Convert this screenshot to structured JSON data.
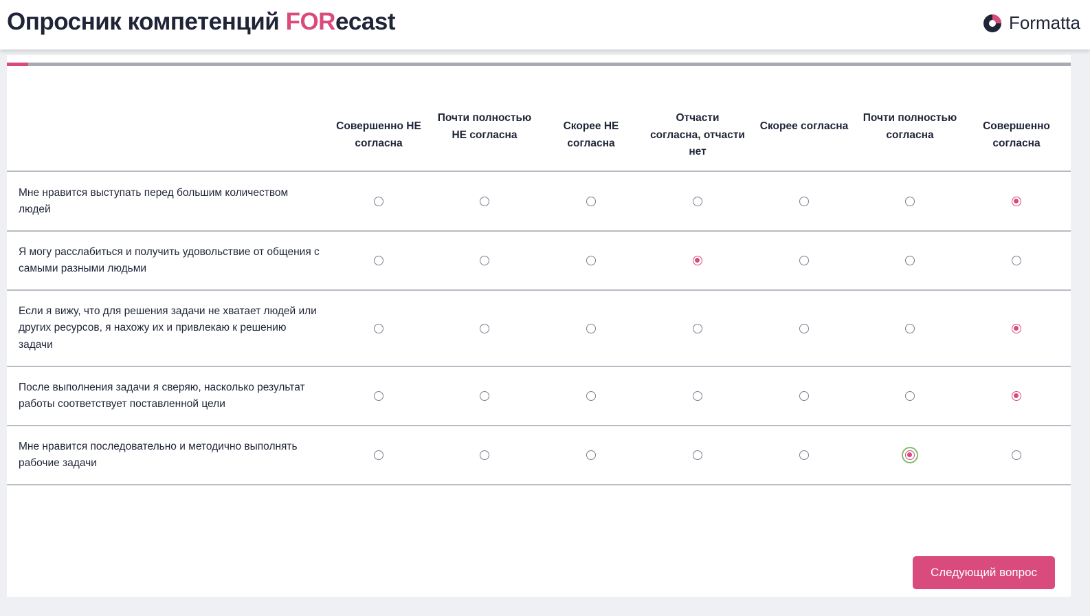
{
  "header": {
    "title_main": "Опросник компетенций ",
    "title_accent": "FOR",
    "title_rest": "ecast",
    "logo_text": "Formatta",
    "logo_icon": "formatta-logo-icon"
  },
  "colors": {
    "accent": "#d94a7d",
    "text": "#1f2537",
    "divider": "#b9bcc4",
    "focus": "#7dbf6a"
  },
  "progress": {
    "value_percent": 2
  },
  "scale": {
    "columns": [
      "Совершенно НЕ согласна",
      "Почти полностью НЕ согласна",
      "Скорее НЕ согласна",
      "Отчасти согласна, отчасти нет",
      "Скорее согласна",
      "Почти полностью согласна",
      "Совершенно согласна"
    ]
  },
  "questions": [
    {
      "text": "Мне нравится выступать перед большим количеством людей",
      "selected_index": 6
    },
    {
      "text": "Я могу расслабиться и получить удовольствие от общения с самыми разными людьми",
      "selected_index": 3
    },
    {
      "text": "Если я вижу, что для решения задачи не хватает людей или других ресурсов, я нахожу их и привлекаю к решению задачи",
      "selected_index": 6
    },
    {
      "text": "После выполнения задачи я сверяю, насколько результат работы соответствует поставленной цели",
      "selected_index": 6
    },
    {
      "text": "Мне нравится последовательно и методично выполнять рабочие задачи",
      "selected_index": 5,
      "focused": true
    }
  ],
  "footer": {
    "next_label": "Следующий вопрос"
  }
}
